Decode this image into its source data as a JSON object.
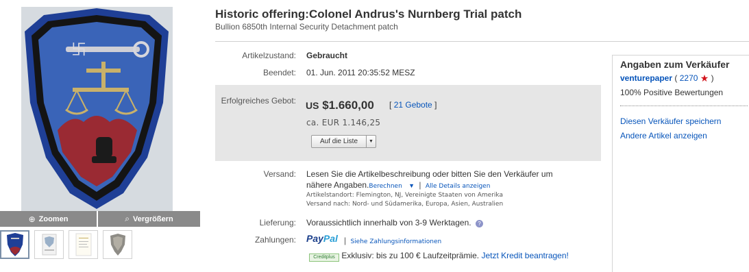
{
  "item": {
    "title": "Historic offering:Colonel Andrus's Nurnberg Trial patch",
    "subtitle": "Bullion 6850th Internal Security Detachment patch"
  },
  "gallery": {
    "zoom_label": "Zoomen",
    "enlarge_label": "Vergrößern",
    "thumbnails": [
      "patch-front",
      "patch-back-document",
      "letter-document",
      "patch-small"
    ]
  },
  "details": {
    "condition_label": "Artikelzustand:",
    "condition_value": "Gebraucht",
    "ended_label": "Beendet:",
    "ended_value": "01. Jun. 2011 20:35:52 MESZ",
    "winning_bid_label": "Erfolgreiches Gebot:",
    "price_currency": "US",
    "price_value": "$1.660,00",
    "bids_open": "[",
    "bids_link": "21 Gebote",
    "bids_close": "]",
    "approx_price": "ca. EUR 1.146,25",
    "watch_button": "Auf die Liste"
  },
  "shipping": {
    "label": "Versand:",
    "text_line1": "Lesen Sie die Artikelbeschreibung oder bitten Sie den Verkäufer um",
    "text_line2": "nähere Angaben.",
    "calc_link": "Berechnen",
    "sep": "|",
    "details_link": "Alle Details anzeigen",
    "location": "Artikelstandort: Flemington, NJ, Vereinigte Staaten von Amerika",
    "ships_to": "Versand nach: Nord- und Südamerika, Europa, Asien, Australien"
  },
  "delivery": {
    "label": "Lieferung:",
    "value": "Voraussichtlich innerhalb von 3-9 Werktagen."
  },
  "payment": {
    "label": "Zahlungen:",
    "paypal_part1": "Pay",
    "paypal_part2": "Pal",
    "sep": "|",
    "info_link": "Siehe Zahlungsinformationen",
    "credit_badge": "Creditplus",
    "credit_text": "Exklusiv: bis zu 100 € Laufzeitprämie.",
    "credit_link": "Jetzt Kredit beantragen!"
  },
  "seller": {
    "title": "Angaben zum Verkäufer",
    "name": "venturepaper",
    "open_paren": "(",
    "score": "2270",
    "close_paren": ")",
    "positive": "100% Positive Bewertungen",
    "save_link": "Diesen Verkäufer speichern",
    "other_items_link": "Andere Artikel anzeigen"
  },
  "colors": {
    "link": "#0654ba",
    "patch_blue": "#2f56a8",
    "patch_red": "#9a2a33",
    "price_box": "#e6e6e6"
  }
}
